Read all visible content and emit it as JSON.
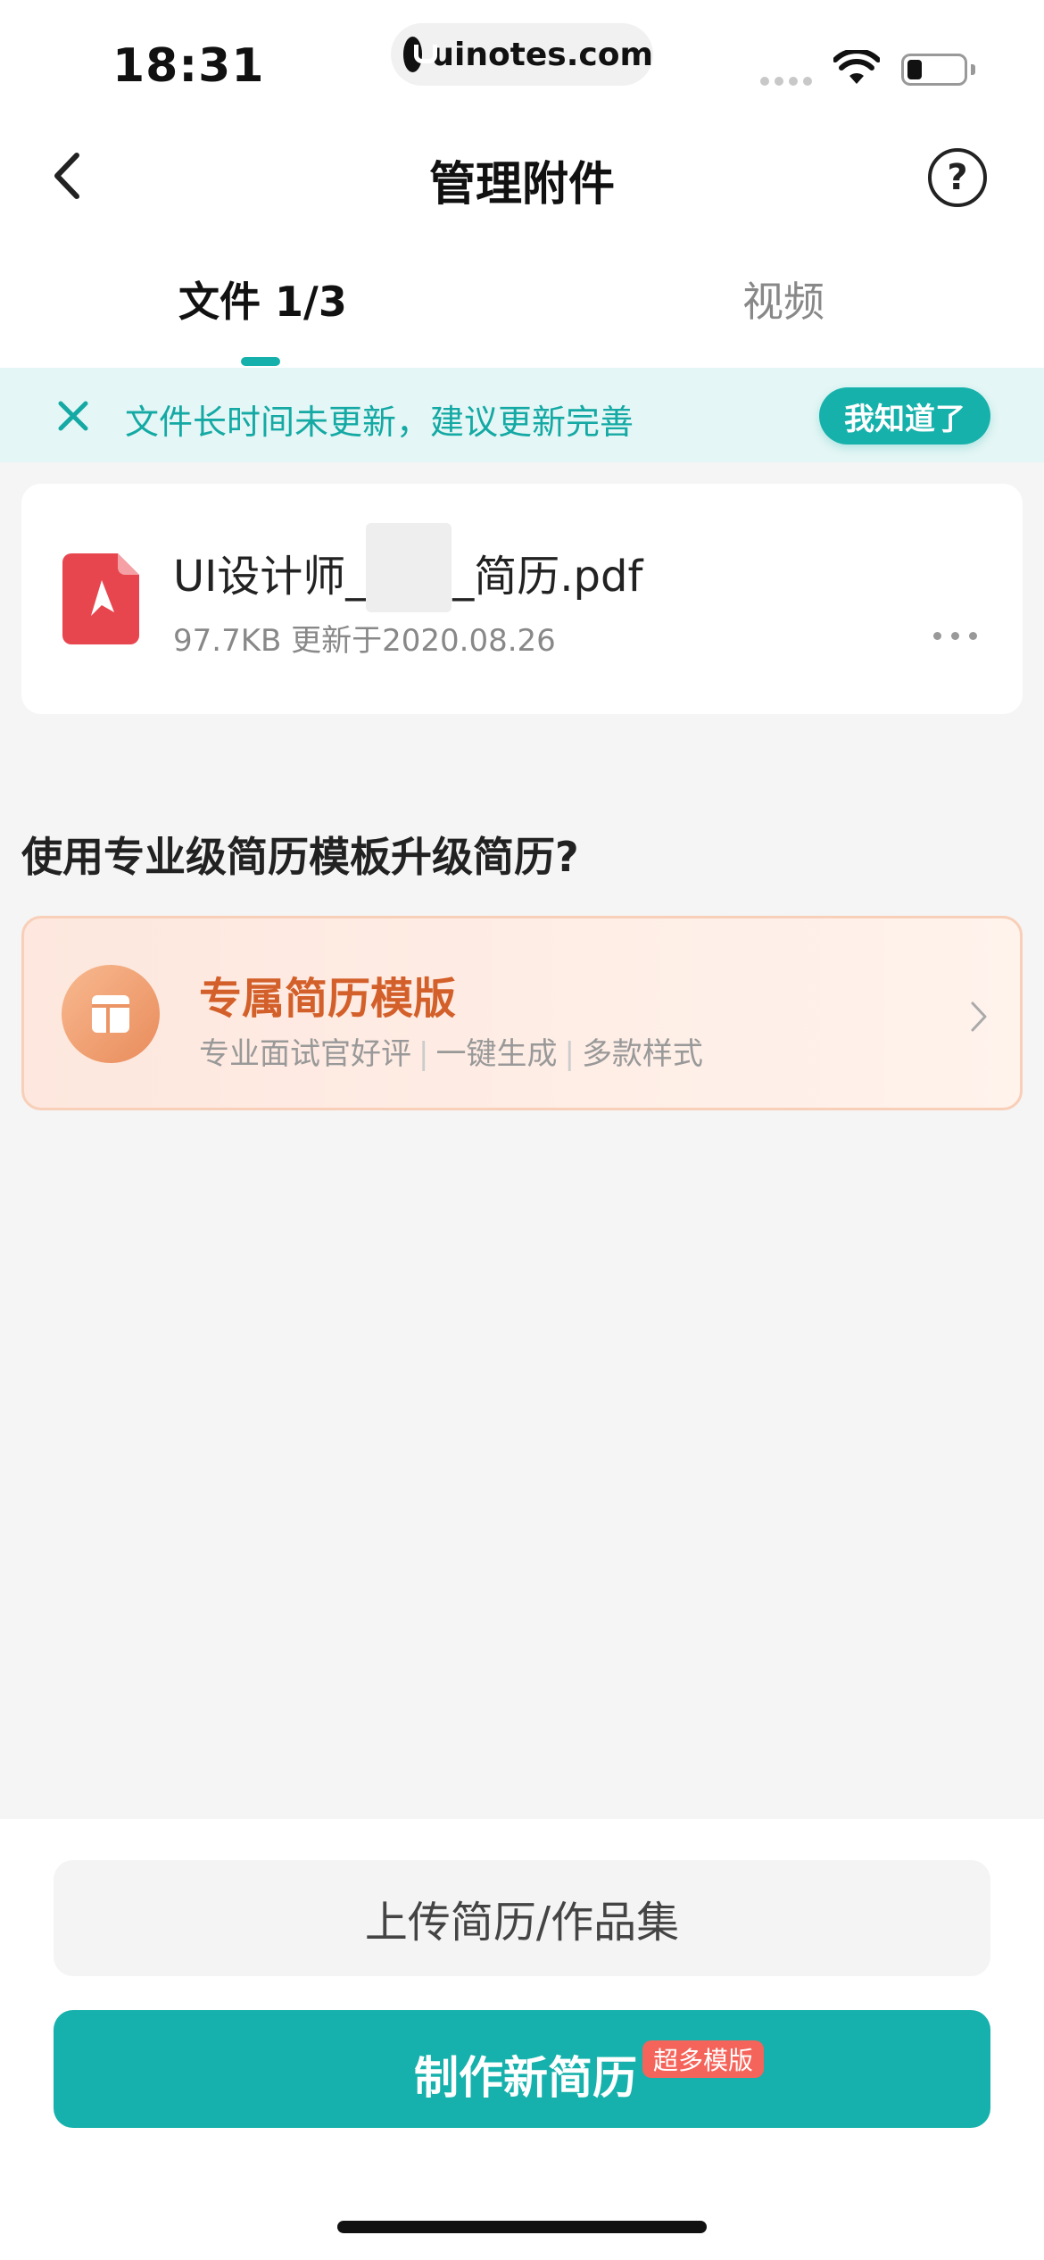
{
  "status_bar": {
    "time": "18:31",
    "url": "uinotes.com"
  },
  "header": {
    "title": "管理附件",
    "help_symbol": "?"
  },
  "tabs": [
    {
      "label": "文件 1/3",
      "active": true
    },
    {
      "label": "视频",
      "active": false
    }
  ],
  "notice": {
    "text": "文件长时间未更新，建议更新完善",
    "button": "我知道了"
  },
  "file": {
    "name_prefix": "UI设计师_",
    "name_suffix": "_简历.pdf",
    "meta": "97.7KB 更新于2020.08.26"
  },
  "upgrade": {
    "question": "使用专业级简历模板升级简历?",
    "card_title": "专属简历模版",
    "features": [
      "专业面试官好评",
      "一键生成",
      "多款样式"
    ]
  },
  "bottom": {
    "upload_label": "上传简历/作品集",
    "make_label": "制作新简历",
    "make_badge": "超多模版"
  },
  "colors": {
    "accent": "#16b1ac",
    "notice_bg": "#e4f6f5",
    "template_title": "#d3602a",
    "badge": "#f4645a",
    "pdf_red": "#e8464f"
  },
  "icons": {
    "back": "chevron-left-icon",
    "help": "question-circle-icon",
    "close": "close-icon",
    "file": "pdf-file-icon",
    "more": "more-dots-icon",
    "template": "template-icon",
    "chevron": "chevron-right-icon"
  }
}
